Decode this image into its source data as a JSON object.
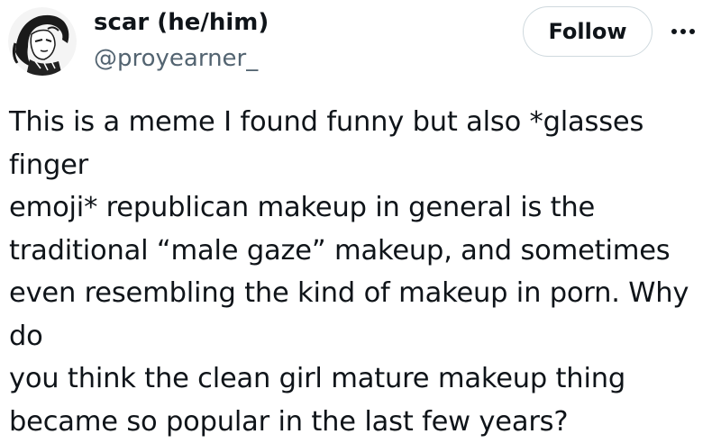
{
  "author": {
    "display_name": "scar (he/him)",
    "handle": "@proyearner_",
    "avatar_icon": "anime-character-avatar-icon"
  },
  "actions": {
    "follow_label": "Follow",
    "more_icon": "more-horizontal-icon"
  },
  "tweet": {
    "text": "This is a meme I found funny but also *glasses finger\nemoji* republican makeup in general is the\ntraditional “male gaze” makeup, and sometimes\neven resembling the kind of makeup in porn. Why do\nyou think the clean girl mature makeup thing\nbecame so popular in the last few years?"
  },
  "colors": {
    "text_primary": "#0f1419",
    "text_secondary": "#536471",
    "border": "#cfd9de"
  }
}
